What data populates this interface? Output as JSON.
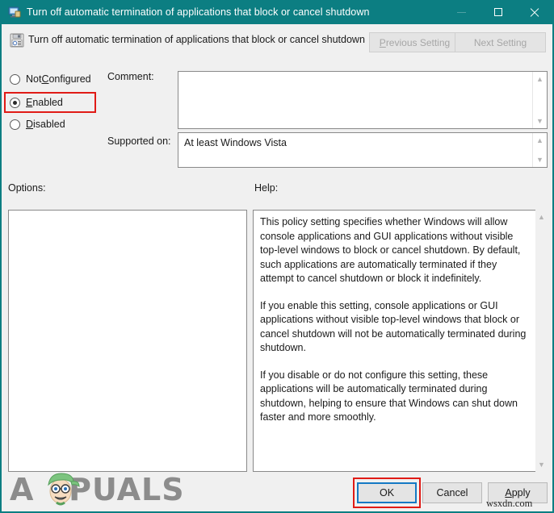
{
  "window": {
    "title": "Turn off automatic termination of applications that block or cancel shutdown",
    "icon": "computer-policy-icon",
    "controls": {
      "minimize": "minimize-icon",
      "maximize": "maximize-icon",
      "close": "close-icon"
    }
  },
  "header": {
    "policy_icon": "policy-setting-icon",
    "policy_title": "Turn off automatic termination of applications that block or cancel shutdown",
    "previous_setting": "Previous Setting",
    "previous_setting_mnemonic": "P",
    "previous_setting_rest": "revious Setting",
    "next_setting": "Next Setting",
    "previous_enabled": false,
    "next_enabled": false
  },
  "state": {
    "options": [
      {
        "label": "Not Configured",
        "mnemonic": "C",
        "before": "Not ",
        "after": "onfigured",
        "selected": false
      },
      {
        "label": "Enabled",
        "mnemonic": "E",
        "before": "",
        "after": "nabled",
        "selected": true
      },
      {
        "label": "Disabled",
        "mnemonic": "D",
        "before": "",
        "after": "isabled",
        "selected": false
      }
    ]
  },
  "fields": {
    "comment_label": "Comment:",
    "comment_value": "",
    "supported_on_label": "Supported on:",
    "supported_on_value": "At least Windows Vista"
  },
  "panels": {
    "options_label": "Options:",
    "options_content": "",
    "help_label": "Help:",
    "help_paragraphs": [
      "This policy setting specifies whether Windows will allow console applications and GUI applications without visible top-level windows to block or cancel shutdown. By default, such applications are automatically terminated if they attempt to cancel shutdown or block it indefinitely.",
      "If you enable this setting, console applications or GUI applications without visible top-level windows that block or cancel shutdown will not be automatically terminated during shutdown.",
      "If you disable or do not configure this setting, these applications will be automatically terminated during shutdown, helping to ensure that Windows can shut down faster and more smoothly."
    ]
  },
  "footer": {
    "ok": "OK",
    "cancel": "Cancel",
    "apply": "Apply",
    "apply_mnemonic": "A",
    "apply_rest": "pply"
  },
  "watermarks": {
    "site": "wsxdn.com",
    "logo_prefix": "A",
    "logo_suffix": "PUALS"
  },
  "annotations": {
    "enabled_highlight": "red-rectangle-around-enabled-radio",
    "ok_highlight": "red-rectangle-around-ok-button"
  },
  "colors": {
    "titlebar": "#0c7e82",
    "annotation_red": "#e01b16",
    "focus_blue": "#1479c4",
    "dialog_bg": "#f0f0f0",
    "logo_gray": "#8c8c8c"
  }
}
